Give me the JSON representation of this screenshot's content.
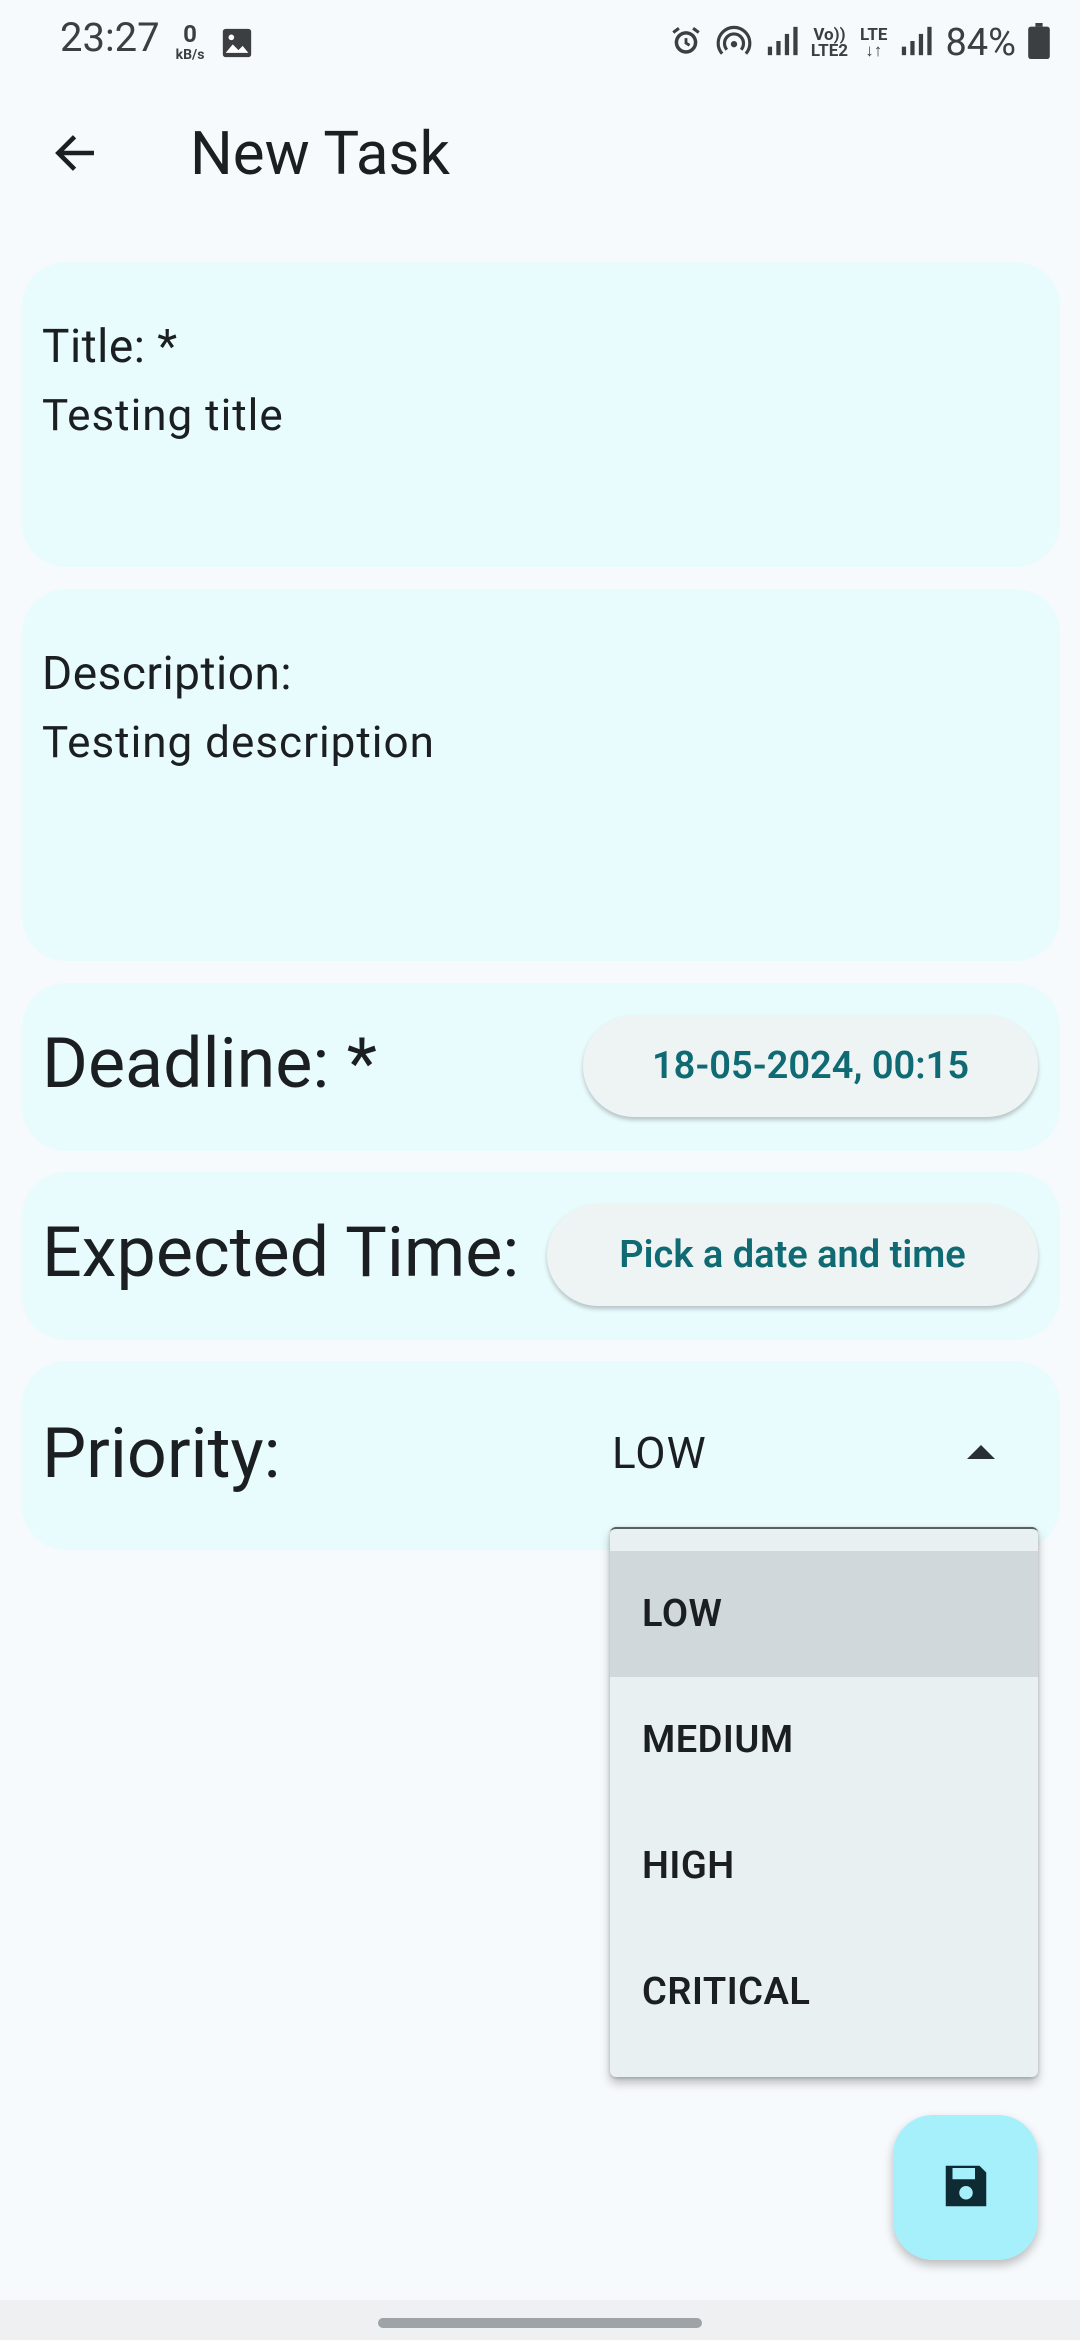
{
  "status_bar": {
    "time": "23:27",
    "net_speed_value": "0",
    "net_speed_unit": "kB/s",
    "volte_top": "Vo))",
    "volte_bottom": "LTE2",
    "lte_label": "LTE",
    "battery": "84%",
    "icons": [
      "gallery-icon",
      "alarm-icon",
      "hotspot-icon",
      "signal-icon",
      "signal-icon",
      "battery-icon"
    ]
  },
  "app_bar": {
    "title": "New Task",
    "back_icon": "arrow-left-icon"
  },
  "form": {
    "title_label": "Title: *",
    "title_value": "Testing title",
    "description_label": "Description:",
    "description_value": "Testing description",
    "deadline_label": "Deadline: *",
    "deadline_value": "18-05-2024, 00:15",
    "expected_time_label": "Expected Time:",
    "expected_time_value": "Pick a date and time",
    "priority_label": "Priority:",
    "priority_value": "LOW"
  },
  "priority_menu": {
    "options": [
      "LOW",
      "MEDIUM",
      "HIGH",
      "CRITICAL"
    ],
    "selected": "LOW"
  },
  "fab": {
    "icon": "save-icon"
  },
  "colors": {
    "card_bg": "#e8fbfd",
    "accent_text": "#0f6a73",
    "fab_bg": "#a6f0fc",
    "menu_bg": "#e8f0f2",
    "menu_selected": "#d0d8db"
  }
}
